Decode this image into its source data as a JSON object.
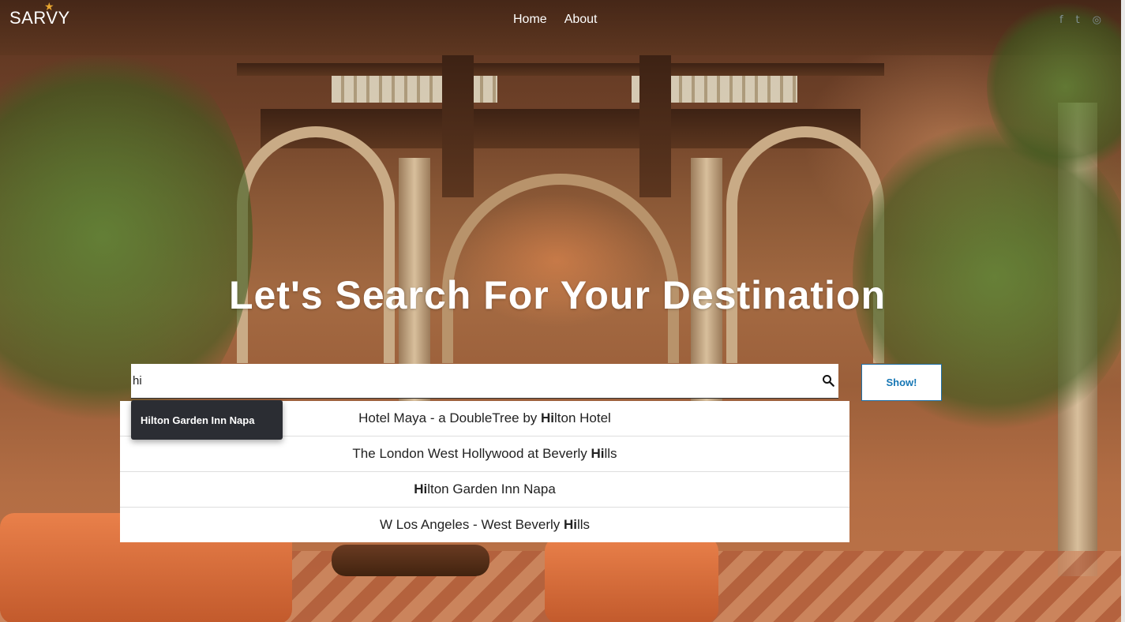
{
  "brand": {
    "logo_text": "SARVY",
    "logo_star": "★"
  },
  "nav": {
    "items": [
      "Home",
      "About"
    ]
  },
  "social": {
    "icons": [
      "facebook-icon",
      "twitter-icon",
      "instagram-icon"
    ],
    "glyphs": [
      "f",
      "t",
      "◎"
    ]
  },
  "hero": {
    "title": "Let's Search For Your Destination"
  },
  "search": {
    "value": "hi",
    "placeholder": ""
  },
  "show_button": {
    "label": "Show!"
  },
  "suggestions": [
    {
      "before": "Hotel Maya - a DoubleTree by ",
      "match": "Hi",
      "after": "lton Hotel"
    },
    {
      "before": "The London West Hollywood at Beverly ",
      "match": "Hi",
      "after": "lls"
    },
    {
      "before": "",
      "match": "Hi",
      "after": "lton Garden Inn Napa"
    },
    {
      "before": "W Los Angeles - West Beverly ",
      "match": "Hi",
      "after": "lls"
    }
  ],
  "tooltip": {
    "text": "Hilton Garden Inn Napa"
  },
  "colors": {
    "accent": "#1576b4",
    "tooltip_bg": "#2b2d33",
    "logo_star": "#e9a630"
  }
}
